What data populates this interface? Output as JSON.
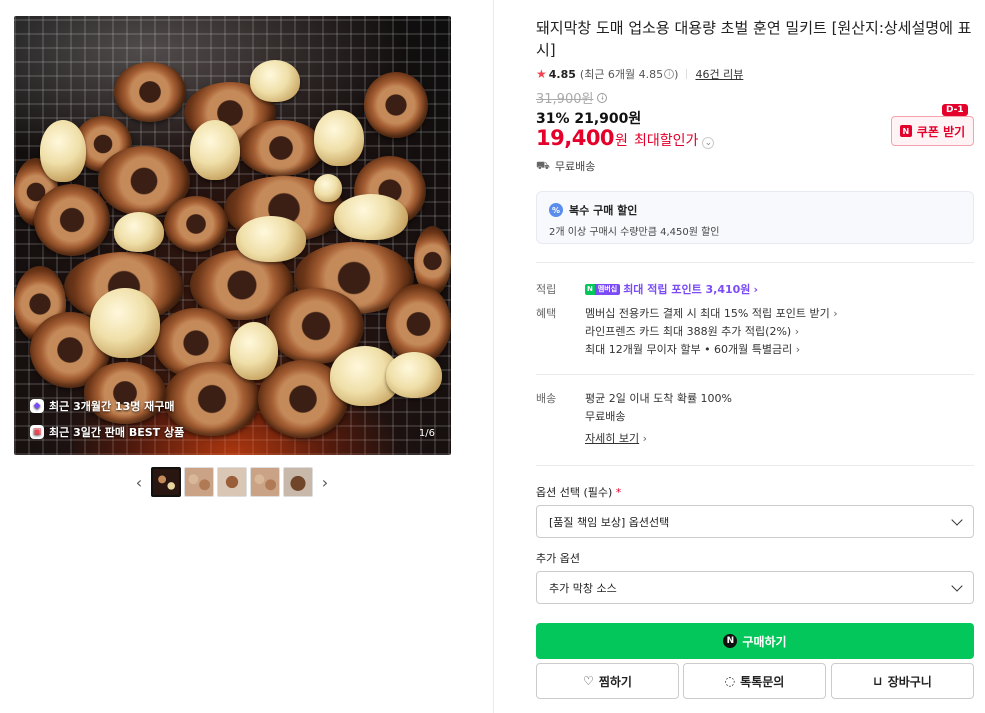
{
  "gallery": {
    "badge_repurchase": "최근 3개월간 13명 재구매",
    "badge_best": "최근 3일간 판매 BEST 상품",
    "counter": "1/6",
    "prev_arrow": "‹",
    "next_arrow": "›"
  },
  "product": {
    "title": "돼지막창 도매 업소용 대용량 초벌 훈연 밀키트 [원산지:상세설명에 표시]",
    "rating": "4.85",
    "rating_recent": "(최근 6개월 4.85",
    "rating_close": ")",
    "reviews": "46건 리뷰",
    "original_price": "31,900원",
    "discount_line": "31% 21,900원",
    "final_price": "19,400",
    "final_won": "원",
    "final_label": "최대할인가",
    "coupon_label": "쿠폰 받기",
    "dday": "D-1",
    "shipping_free": "무료배송"
  },
  "bulk": {
    "title": "복수 구매 할인",
    "desc": "2개 이상 구매시 수량만큼 4,450원 할인"
  },
  "points": {
    "key": "적립",
    "tag_g": "N",
    "tag_p": "멤버십",
    "text": "최대 적립 포인트 3,410원"
  },
  "benefits": {
    "key": "혜택",
    "line1": "멤버십 전용카드 결제 시 최대 15% 적립 포인트 받기",
    "line2": "라인프렌즈 카드 최대 388원 추가 적립(2%)",
    "line3": "최대 12개월 무이자 할부 • 60개월 특별금리"
  },
  "delivery": {
    "key": "배송",
    "line1": "평균 2일 이내 도착 확률 100%",
    "line2": "무료배송",
    "details": "자세히 보기"
  },
  "options": {
    "label": "옵션 선택 (필수)",
    "required_mark": "*",
    "select_value": "[품질 책임 보상] 옵션선택",
    "extra_label": "추가 옵션",
    "extra_value": "추가 막창 소스"
  },
  "actions": {
    "buy": "구매하기",
    "wish": "찜하기",
    "talk": "톡톡문의",
    "cart": "장바구니"
  },
  "colors": {
    "accent_green": "#03c75a",
    "price_red": "#e4002b",
    "membership_purple": "#7b4cf6"
  }
}
